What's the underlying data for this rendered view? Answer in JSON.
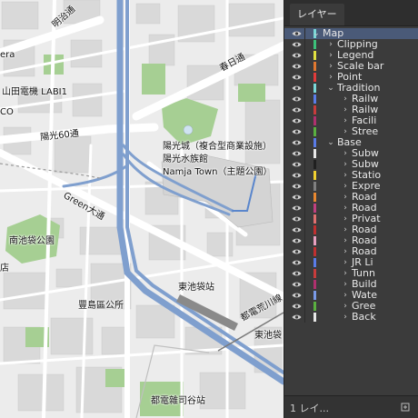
{
  "map": {
    "labels": [
      {
        "id": "label-meiji-dori",
        "text": "明治通"
      },
      {
        "id": "label-kasuga-dori",
        "text": "春日通"
      },
      {
        "id": "label-yamada-denki",
        "text": "山田電機 LABI1"
      },
      {
        "id": "label-era",
        "text": "era"
      },
      {
        "id": "label-co",
        "text": "CO"
      },
      {
        "id": "label-yoko-60",
        "text": "陽光60通"
      },
      {
        "id": "label-sunshine-city",
        "text": "陽光城（複合型商業設施）"
      },
      {
        "id": "label-aquarium",
        "text": "陽光水族館"
      },
      {
        "id": "label-namja-town",
        "text": "Namja Town（主題公園）"
      },
      {
        "id": "label-green-dori",
        "text": "Green大通"
      },
      {
        "id": "label-minami-park",
        "text": "南池袋公園"
      },
      {
        "id": "label-ten",
        "text": "店"
      },
      {
        "id": "label-higashi-station",
        "text": "東池袋站"
      },
      {
        "id": "label-toshima-office",
        "text": "豐島區公所"
      },
      {
        "id": "label-toden-arakawa",
        "text": "都電荒川線"
      },
      {
        "id": "label-higashi-ikebukuro",
        "text": "東池袋"
      },
      {
        "id": "label-zoshigaya-station",
        "text": "都電雜司谷站"
      }
    ]
  },
  "panel": {
    "tab_label": "レイヤー",
    "footer_text": "1 レイ...",
    "layers": [
      {
        "name": "Map",
        "color": "#7ad8d8",
        "depth": 0,
        "twirl": "open",
        "selected": true
      },
      {
        "name": "Clipping",
        "color": "#3cc17a",
        "depth": 1,
        "twirl": "closed"
      },
      {
        "name": "Legend",
        "color": "#e0e040",
        "depth": 1,
        "twirl": "closed"
      },
      {
        "name": "Scale bar",
        "color": "#e07830",
        "depth": 1,
        "twirl": "closed"
      },
      {
        "name": "Point",
        "color": "#e23b3b",
        "depth": 1,
        "twirl": "closed"
      },
      {
        "name": "Tradition",
        "color": "#7ad8d8",
        "depth": 1,
        "twirl": "open"
      },
      {
        "name": "Railw",
        "color": "#5a7ce8",
        "depth": 2,
        "twirl": "closed"
      },
      {
        "name": "Railw",
        "color": "#c83c3c",
        "depth": 2,
        "twirl": "closed"
      },
      {
        "name": "Facili",
        "color": "#b0306e",
        "depth": 2,
        "twirl": "closed"
      },
      {
        "name": "Stree",
        "color": "#5ab040",
        "depth": 2,
        "twirl": "closed"
      },
      {
        "name": "Base",
        "color": "#5a7ce8",
        "depth": 1,
        "twirl": "open"
      },
      {
        "name": "Subw",
        "color": "#e8e8e8",
        "depth": 2,
        "twirl": "closed"
      },
      {
        "name": "Subw",
        "color": "#202020",
        "depth": 2,
        "twirl": "closed"
      },
      {
        "name": "Statio",
        "color": "#f0d030",
        "depth": 2,
        "twirl": "closed"
      },
      {
        "name": "Expre",
        "color": "#808080",
        "depth": 2,
        "twirl": "closed"
      },
      {
        "name": "Road",
        "color": "#e88830",
        "depth": 2,
        "twirl": "closed"
      },
      {
        "name": "Road",
        "color": "#c04080",
        "depth": 2,
        "twirl": "closed"
      },
      {
        "name": "Privat",
        "color": "#e07070",
        "depth": 2,
        "twirl": "closed"
      },
      {
        "name": "Road",
        "color": "#c03030",
        "depth": 2,
        "twirl": "closed"
      },
      {
        "name": "Road",
        "color": "#e8a0c0",
        "depth": 2,
        "twirl": "closed"
      },
      {
        "name": "Road",
        "color": "#c03030",
        "depth": 2,
        "twirl": "closed"
      },
      {
        "name": "JR Li",
        "color": "#5a7ce8",
        "depth": 2,
        "twirl": "closed"
      },
      {
        "name": "Tunn",
        "color": "#c83c3c",
        "depth": 2,
        "twirl": "closed"
      },
      {
        "name": "Build",
        "color": "#b0306e",
        "depth": 2,
        "twirl": "closed"
      },
      {
        "name": "Wate",
        "color": "#7a9ae8",
        "depth": 2,
        "twirl": "closed"
      },
      {
        "name": "Gree",
        "color": "#5ab040",
        "depth": 2,
        "twirl": "closed"
      },
      {
        "name": "Back",
        "color": "#e8e8e8",
        "depth": 2,
        "twirl": "closed"
      }
    ]
  }
}
